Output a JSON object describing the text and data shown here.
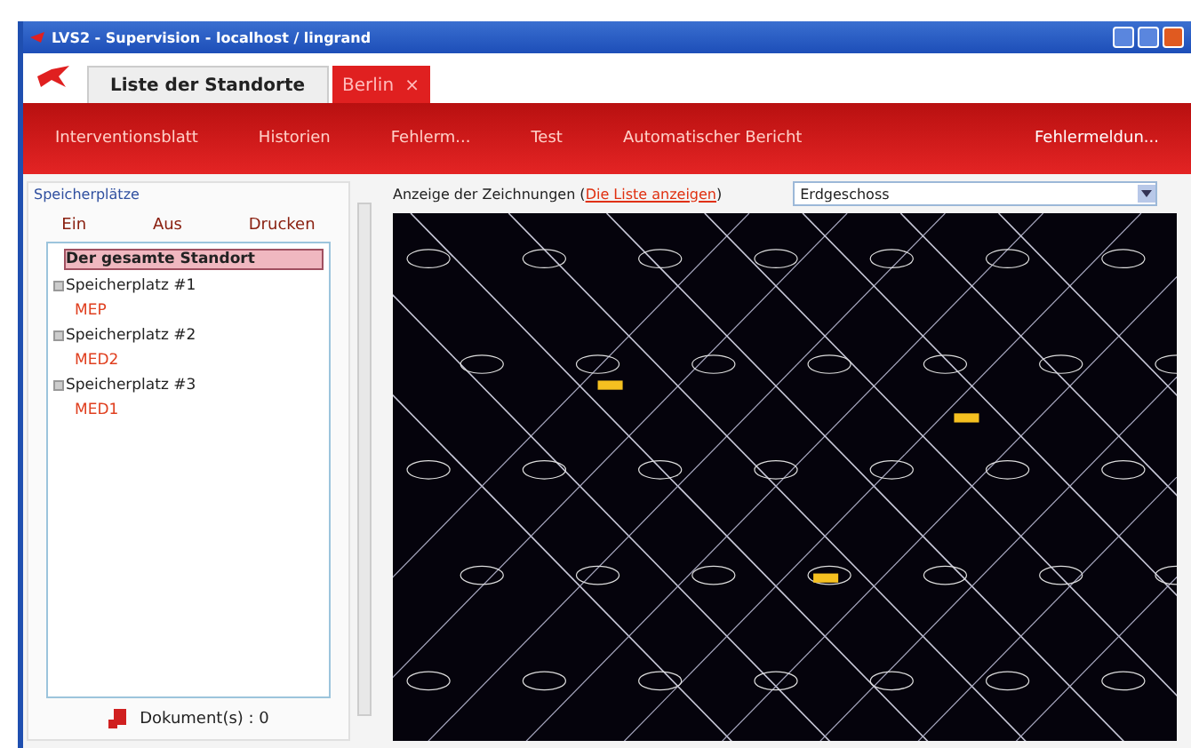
{
  "window": {
    "title": "LVS2 - Supervision - localhost / lingrand"
  },
  "tabs": [
    {
      "label": "Liste der Standorte",
      "selected": false
    },
    {
      "label": "Berlin",
      "selected": true,
      "close": "×"
    }
  ],
  "menu": [
    "Interventionsblatt",
    "Historien",
    "Fehlerm...",
    "Test",
    "Automatischer Bericht",
    "Fehlermeldun..."
  ],
  "sidebar": {
    "title": "Speicherplätze",
    "buttons": [
      "Ein",
      "Aus",
      "Drucken"
    ],
    "tree": [
      {
        "label": "Der gesamte Standort",
        "selected": true
      },
      {
        "label": "Speicherplatz #1",
        "selected": false,
        "expanded": true,
        "children": [
          {
            "label": "MEP",
            "selected": false
          }
        ]
      },
      {
        "label": "Speicherplatz #2",
        "selected": false,
        "expanded": true,
        "children": [
          {
            "label": "MED2",
            "selected": false
          }
        ]
      },
      {
        "label": "Speicherplatz #3",
        "selected": false,
        "expanded": true,
        "children": [
          {
            "label": "MED1",
            "selected": false
          }
        ]
      }
    ],
    "documents": "Dokument(s) : 0"
  },
  "drawing": {
    "label": "Anzeige der Zeichnungen (",
    "link": "Die Liste anzeigen",
    "label_end": ")",
    "floor": "Erdgeschoss"
  }
}
